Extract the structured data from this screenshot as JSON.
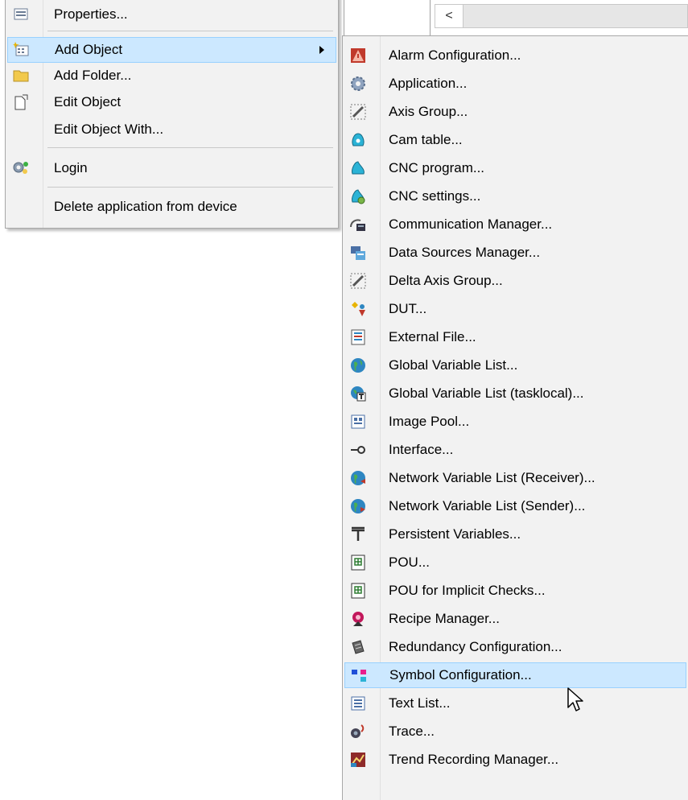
{
  "scroll": {
    "left_arrow": "<"
  },
  "main_menu": {
    "items": [
      {
        "label": "Properties...",
        "icon": "properties-icon"
      },
      {
        "label": "Add Object",
        "icon": "add-object-icon",
        "submenu": true,
        "highlighted": true
      },
      {
        "label": "Add Folder...",
        "icon": "folder-icon"
      },
      {
        "label": "Edit Object",
        "icon": "edit-object-icon"
      },
      {
        "label": "Edit Object With...",
        "icon": ""
      },
      {
        "label": "Login",
        "icon": "login-icon"
      },
      {
        "label": "Delete application from device",
        "icon": ""
      }
    ]
  },
  "sub_menu": {
    "items": [
      {
        "label": "Alarm Configuration...",
        "icon": "alarm-icon"
      },
      {
        "label": "Application...",
        "icon": "application-gear-icon"
      },
      {
        "label": "Axis Group...",
        "icon": "axis-group-icon"
      },
      {
        "label": "Cam table...",
        "icon": "cam-table-icon"
      },
      {
        "label": "CNC program...",
        "icon": "cnc-program-icon"
      },
      {
        "label": "CNC settings...",
        "icon": "cnc-settings-icon"
      },
      {
        "label": "Communication Manager...",
        "icon": "communication-icon"
      },
      {
        "label": "Data Sources Manager...",
        "icon": "data-sources-icon"
      },
      {
        "label": "Delta Axis Group...",
        "icon": "delta-axis-icon"
      },
      {
        "label": "DUT...",
        "icon": "dut-icon"
      },
      {
        "label": "External File...",
        "icon": "external-file-icon"
      },
      {
        "label": "Global Variable List...",
        "icon": "globe-icon"
      },
      {
        "label": "Global Variable List (tasklocal)...",
        "icon": "globe-task-icon"
      },
      {
        "label": "Image Pool...",
        "icon": "image-pool-icon"
      },
      {
        "label": "Interface...",
        "icon": "interface-icon"
      },
      {
        "label": "Network Variable List (Receiver)...",
        "icon": "network-globe-icon"
      },
      {
        "label": "Network Variable List (Sender)...",
        "icon": "network-globe-icon"
      },
      {
        "label": "Persistent Variables...",
        "icon": "persistent-icon"
      },
      {
        "label": "POU...",
        "icon": "pou-icon"
      },
      {
        "label": "POU for Implicit Checks...",
        "icon": "pou-icon"
      },
      {
        "label": "Recipe Manager...",
        "icon": "recipe-icon"
      },
      {
        "label": "Redundancy Configuration...",
        "icon": "redundancy-icon"
      },
      {
        "label": "Symbol Configuration...",
        "icon": "symbol-config-icon",
        "highlighted": true
      },
      {
        "label": "Text List...",
        "icon": "text-list-icon"
      },
      {
        "label": "Trace...",
        "icon": "trace-icon"
      },
      {
        "label": "Trend Recording Manager...",
        "icon": "trend-icon"
      }
    ]
  },
  "colors": {
    "highlight_bg": "#cce8ff",
    "highlight_border": "#99d1ff",
    "menu_bg": "#f2f2f2"
  }
}
